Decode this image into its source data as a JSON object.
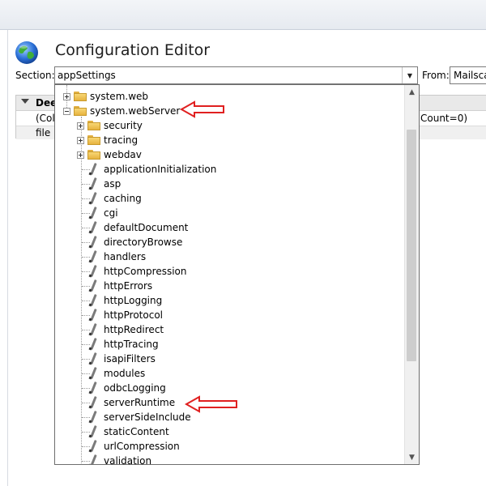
{
  "window": {
    "title": "Configuration Editor"
  },
  "section": {
    "label": "Section:",
    "value": "appSettings"
  },
  "from": {
    "label": "From:",
    "value": "Mailsca"
  },
  "grid": {
    "header_fragment": "Dee",
    "row1_left_fragment": "(Col",
    "row1_right_fragment": "Count=0)",
    "row2_fragment": "file"
  },
  "tree": {
    "items": [
      {
        "label": "system.web",
        "kind": "folder",
        "expander": "plus"
      },
      {
        "label": "system.webServer",
        "kind": "folder",
        "expander": "minus"
      },
      {
        "label": "security",
        "kind": "folder",
        "expander": "plus"
      },
      {
        "label": "tracing",
        "kind": "folder",
        "expander": "plus"
      },
      {
        "label": "webdav",
        "kind": "folder",
        "expander": "plus"
      },
      {
        "label": "applicationInitialization",
        "kind": "section"
      },
      {
        "label": "asp",
        "kind": "section"
      },
      {
        "label": "caching",
        "kind": "section"
      },
      {
        "label": "cgi",
        "kind": "section"
      },
      {
        "label": "defaultDocument",
        "kind": "section"
      },
      {
        "label": "directoryBrowse",
        "kind": "section"
      },
      {
        "label": "handlers",
        "kind": "section"
      },
      {
        "label": "httpCompression",
        "kind": "section"
      },
      {
        "label": "httpErrors",
        "kind": "section"
      },
      {
        "label": "httpLogging",
        "kind": "section"
      },
      {
        "label": "httpProtocol",
        "kind": "section"
      },
      {
        "label": "httpRedirect",
        "kind": "section"
      },
      {
        "label": "httpTracing",
        "kind": "section"
      },
      {
        "label": "isapiFilters",
        "kind": "section"
      },
      {
        "label": "modules",
        "kind": "section"
      },
      {
        "label": "odbcLogging",
        "kind": "section"
      },
      {
        "label": "serverRuntime",
        "kind": "section"
      },
      {
        "label": "serverSideInclude",
        "kind": "section"
      },
      {
        "label": "staticContent",
        "kind": "section"
      },
      {
        "label": "urlCompression",
        "kind": "section"
      },
      {
        "label": "validation",
        "kind": "section"
      }
    ]
  },
  "colors": {
    "annotation_arrow": "#e02020",
    "globe_ocean": "#2a6fd6",
    "globe_land": "#3fae3a"
  },
  "icons": {
    "globe": "globe-icon",
    "folder": "folder-icon",
    "section": "pencil-icon",
    "dropdown": "chevron-down-icon"
  }
}
